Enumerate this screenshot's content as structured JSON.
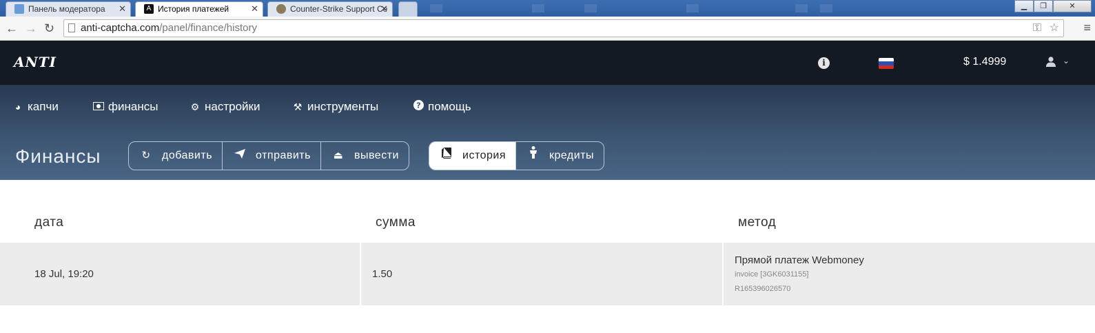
{
  "browser": {
    "tabs": [
      {
        "title": "Панель модератора",
        "active": false
      },
      {
        "title": "История платежей",
        "active": true
      },
      {
        "title": "Counter-Strike Support Ce",
        "active": false
      }
    ],
    "url_host": "anti-captcha.com",
    "url_path": "/panel/finance/history"
  },
  "header": {
    "logo": "ANTI",
    "balance": "$ 1.4999"
  },
  "menu": {
    "items": [
      {
        "label": "капчи",
        "icon": "pie-chart-icon"
      },
      {
        "label": "финансы",
        "icon": "money-icon"
      },
      {
        "label": "настройки",
        "icon": "gear-icon"
      },
      {
        "label": "инструменты",
        "icon": "tools-icon"
      },
      {
        "label": "помощь",
        "icon": "question-icon"
      }
    ]
  },
  "finance": {
    "title": "Финансы",
    "actions": [
      {
        "label": "добавить",
        "icon": "refresh-icon"
      },
      {
        "label": "отправить",
        "icon": "paper-plane-icon"
      },
      {
        "label": "вывести",
        "icon": "eject-icon"
      }
    ],
    "views": [
      {
        "label": "история",
        "icon": "book-icon",
        "active": true
      },
      {
        "label": "кредиты",
        "icon": "person-icon",
        "active": false
      }
    ]
  },
  "table": {
    "columns": [
      "дата",
      "сумма",
      "метод"
    ],
    "rows": [
      {
        "date": "18 Jul, 19:20",
        "amount": "1.50",
        "method": "Прямой платеж Webmoney",
        "invoice": "invoice [3GK6031155]",
        "purse": "R165396026570"
      }
    ]
  },
  "colors": {
    "topbar": "#141a24",
    "subnav": "#3c5572",
    "row_bg": "#ececec"
  }
}
